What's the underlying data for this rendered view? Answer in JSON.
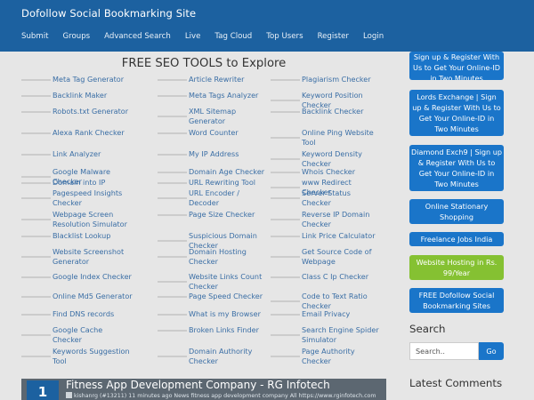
{
  "header": {
    "site_title": "Dofollow Social Bookmarking Site",
    "nav": [
      "Submit",
      "Groups",
      "Advanced Search",
      "Live",
      "Tag Cloud",
      "Top Users",
      "Register",
      "Login"
    ]
  },
  "tools": {
    "title": "FREE SEO TOOLS to Explore",
    "col1": [
      "Meta Tag Generator",
      "Backlink Maker",
      "Robots.txt Generator",
      "Alexa Rank Checker",
      "Link Analyzer",
      "Google Malware Checker",
      "Domain into IP",
      "Pagespeed Insights Checker",
      "Webpage Screen Resolution Simulator",
      "Blacklist Lookup",
      "Website Screenshot Generator",
      "Google Index Checker",
      "Online Md5 Generator",
      "Find DNS records",
      "Google Cache Checker",
      "Keywords Suggestion Tool"
    ],
    "col2": [
      "Article Rewriter",
      "Meta Tags Analyzer",
      "XML Sitemap Generator",
      "Word Counter",
      "My IP Address",
      "Domain Age Checker",
      "URL Rewriting Tool",
      "URL Encoder / Decoder",
      "Page Size Checker",
      "Suspicious Domain Checker",
      "Domain Hosting Checker",
      "Website Links Count Checker",
      "Page Speed Checker",
      "What is my Browser",
      "Broken Links Finder",
      "Domain Authority Checker"
    ],
    "col3": [
      "Plagiarism Checker",
      "Keyword Position Checker",
      "Backlink Checker",
      "Online Ping Website Tool",
      "Keyword Density Checker",
      "Whois Checker",
      "www Redirect Checker",
      "Server Status Checker",
      "Reverse IP Domain Checker",
      "Link Price Calculator",
      "Get Source Code of Webpage",
      "Class C Ip Checker",
      "Code to Text Ratio Checker",
      "Email Privacy",
      "Search Engine Spider Simulator",
      "Page Authority Checker"
    ]
  },
  "sidebar": {
    "buttons": [
      "Sign up & Register With Us to Get Your Online-ID in Two Minutes",
      "Lords Exchange | Sign up & Register With Us to Get Your Online-ID in Two Minutes",
      "Diamond Exch9 | Sign up & Register With Us to Get Your Online-ID in Two Minutes",
      "Online Stationary Shopping",
      "Freelance Jobs India",
      "Website Hosting in Rs. 99/Year",
      "FREE Dofollow Social Bookmarking Sites"
    ],
    "search_heading": "Search",
    "search_placeholder": "Search..",
    "go_label": "Go",
    "latest_heading": "Latest Comments"
  },
  "article": {
    "rank": "1",
    "title": "Fitness App Development Company - RG Infotech",
    "meta": "kishanrg (#13211)  11 minutes ago  News  fitness app development company  All  https://www.rginfotech.com"
  },
  "colors": {
    "header_bg": "#1c61a0",
    "button_blue": "#1a75c9",
    "button_green": "#85c132",
    "link": "#3a6ea5"
  }
}
